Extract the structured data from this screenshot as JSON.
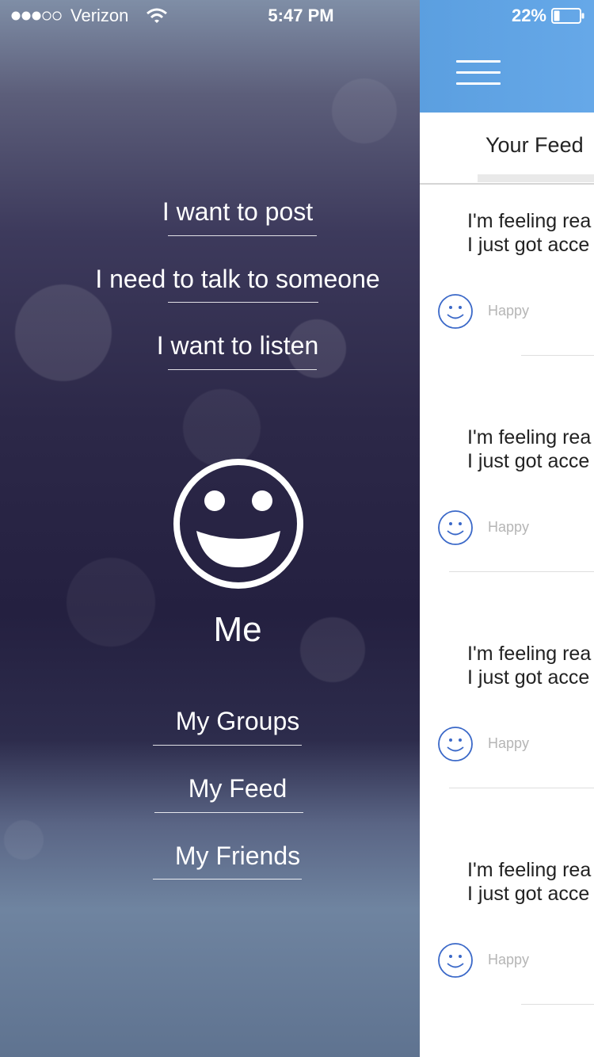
{
  "status_bar": {
    "carrier": "Verizon",
    "time": "5:47 PM",
    "battery": "22%"
  },
  "drawer": {
    "actions": [
      {
        "label": "I want to post"
      },
      {
        "label": "I need to talk to someone"
      },
      {
        "label": "I want to listen"
      }
    ],
    "profile": {
      "label": "Me",
      "icon": "smiley-face-icon"
    },
    "nav": [
      {
        "label": "My Groups"
      },
      {
        "label": "My Feed"
      },
      {
        "label": "My Friends"
      }
    ]
  },
  "feed": {
    "tab_label": "Your Feed",
    "header_color": "#5b9fe0",
    "posts": [
      {
        "line1": "I'm feeling rea",
        "line2": "I just got acce",
        "mood": "Happy"
      },
      {
        "line1": "I'm feeling rea",
        "line2": "I just got acce",
        "mood": "Happy"
      },
      {
        "line1": "I'm feeling rea",
        "line2": "I just got acce",
        "mood": "Happy"
      },
      {
        "line1": "I'm feeling rea",
        "line2": "I just got acce",
        "mood": "Happy"
      }
    ]
  }
}
